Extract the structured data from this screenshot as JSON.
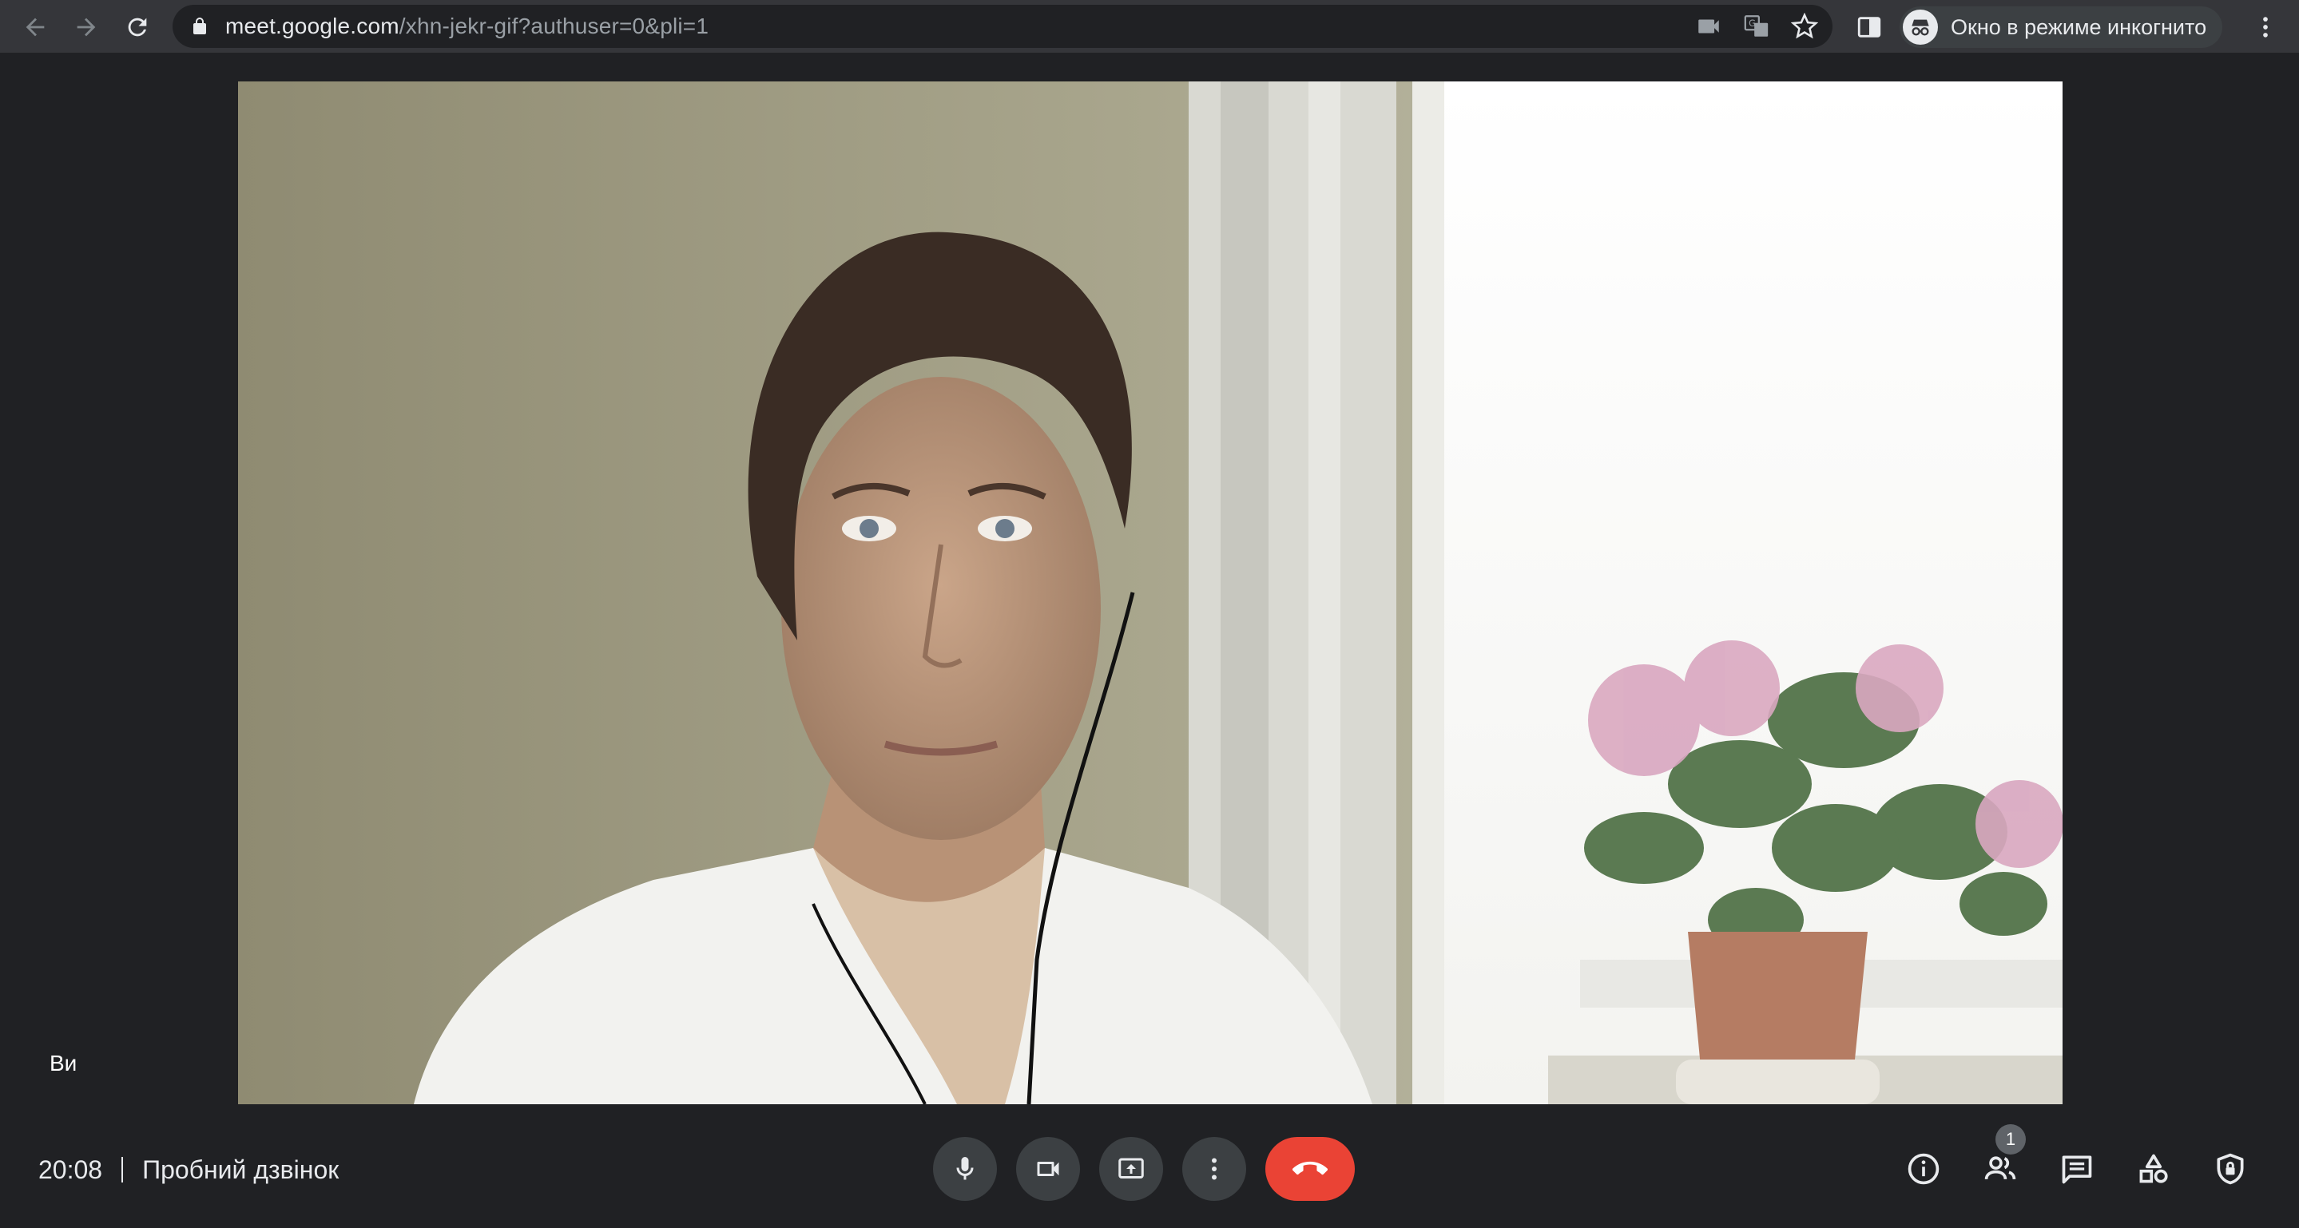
{
  "browser": {
    "url_host": "meet.google.com",
    "url_path": "/xhn-jekr-gif?authuser=0&pli=1",
    "incognito_label": "Окно в режиме инкогнито"
  },
  "icons": {
    "back": "arrow-left",
    "forward": "arrow-right",
    "reload": "refresh",
    "lock": "lock",
    "camera": "video-camera",
    "translate": "translate",
    "bookmark": "star",
    "side_panel": "side-panel",
    "incognito": "incognito-glasses",
    "menu": "kebab"
  },
  "video": {
    "self_label": "Ви"
  },
  "meeting": {
    "time": "20:08",
    "title": "Пробний дзвінок"
  },
  "toolbar": {
    "participants_count": "1"
  },
  "colors": {
    "background": "#202124",
    "chrome_bar": "#35363a",
    "control_button": "#3c4043",
    "end_call": "#ea4335"
  }
}
